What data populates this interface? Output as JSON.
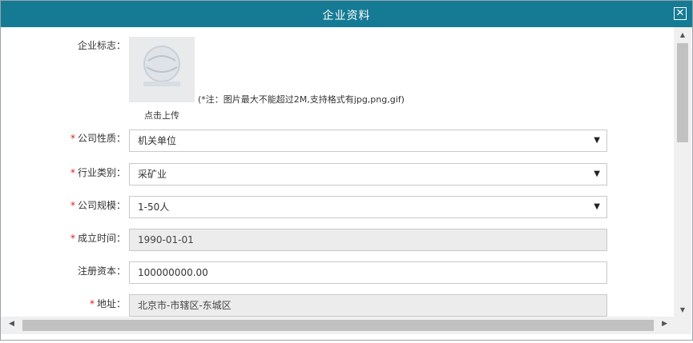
{
  "dialog": {
    "title": "企业资料",
    "close_icon": "close-icon"
  },
  "form": {
    "logo": {
      "label": "企业标志：",
      "note": "(*注：图片最大不能超过2M,支持格式有jpg,png,gif)",
      "upload_label": "点击上传"
    },
    "company_type": {
      "required_mark": "*",
      "label": "公司性质：",
      "value": "机关单位"
    },
    "industry": {
      "required_mark": "*",
      "label": "行业类别：",
      "value": "采矿业"
    },
    "company_size": {
      "required_mark": "*",
      "label": "公司规模：",
      "value": "1-50人"
    },
    "founded_date": {
      "required_mark": "*",
      "label": "成立时间：",
      "value": "1990-01-01"
    },
    "registered_capital": {
      "label": "注册资本：",
      "value": "100000000.00"
    },
    "address": {
      "required_mark": "*",
      "label": "地址：",
      "value": "北京市-市辖区-东城区"
    }
  },
  "colors": {
    "titlebar": "#157a94",
    "required": "#d81e1e",
    "readonly_bg": "#ececec"
  }
}
